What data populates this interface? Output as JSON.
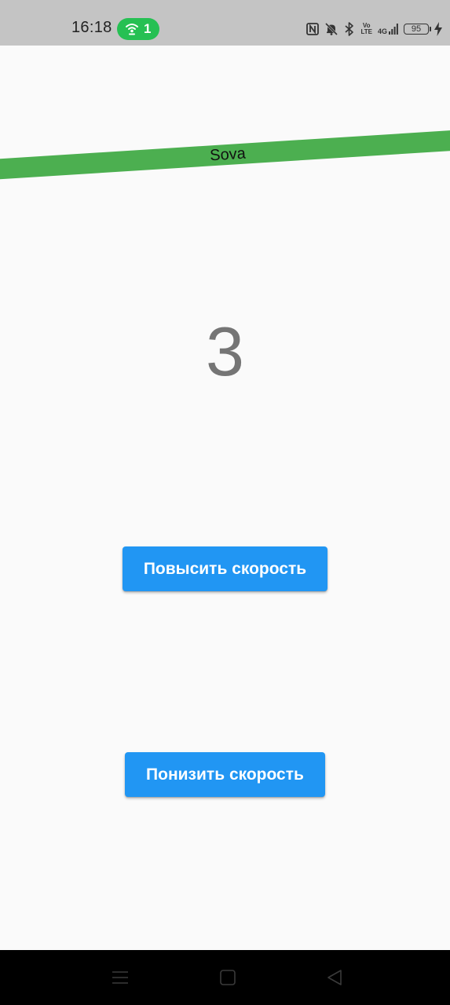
{
  "status_bar": {
    "time": "16:18",
    "hotspot_count": "1",
    "battery_level": "95",
    "volte_label_top": "Vo",
    "volte_label_bottom": "LTE",
    "network_label": "4G",
    "icons": [
      "nfc-icon",
      "muted-bell-icon",
      "bluetooth-icon",
      "volte-icon",
      "signal-icon",
      "battery-icon",
      "charging-icon"
    ]
  },
  "banner": {
    "text": "Sova",
    "color": "#4caf50"
  },
  "counter": {
    "value": "3"
  },
  "buttons": {
    "increase_label": "Повысить скорость",
    "decrease_label": "Понизить скорость",
    "color": "#2196f3"
  },
  "nav_bar": {
    "icons": [
      "menu-icon",
      "home-icon",
      "back-icon"
    ]
  }
}
